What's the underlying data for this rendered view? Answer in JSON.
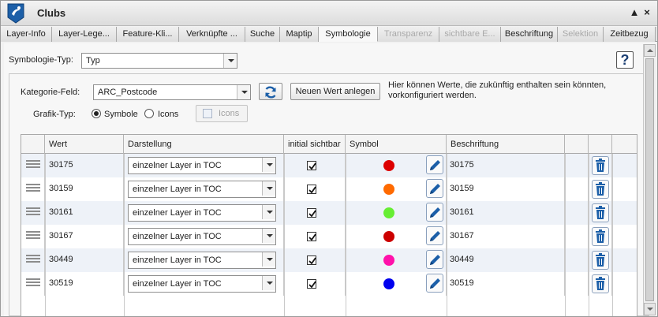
{
  "window": {
    "title": "Clubs",
    "collapse_glyph": "▲",
    "close_glyph": "×"
  },
  "tabs": [
    {
      "label": "Layer-Info",
      "state": "normal"
    },
    {
      "label": "Layer-Lege...",
      "state": "normal"
    },
    {
      "label": "Feature-Kli...",
      "state": "normal"
    },
    {
      "label": "Verknüpfte ...",
      "state": "normal"
    },
    {
      "label": "Suche",
      "state": "normal"
    },
    {
      "label": "Maptip",
      "state": "normal"
    },
    {
      "label": "Symbologie",
      "state": "active"
    },
    {
      "label": "Transparenz",
      "state": "disabled"
    },
    {
      "label": "sichtbare E...",
      "state": "disabled"
    },
    {
      "label": "Beschriftung",
      "state": "normal"
    },
    {
      "label": "Selektion",
      "state": "disabled"
    },
    {
      "label": "Zeitbezug",
      "state": "normal"
    }
  ],
  "symbology": {
    "type_label": "Symbologie-Typ:",
    "type_value": "Typ",
    "help_glyph": "?",
    "category_label": "Kategorie-Feld:",
    "category_value": "ARC_Postcode",
    "new_value_button": "Neuen Wert anlegen",
    "hint": "Hier können Werte, die zukünftig enthalten sein könnten, vorkonfiguriert werden.",
    "graphic_type_label": "Grafik-Typ:",
    "option_symbols": "Symbole",
    "option_icons": "Icons",
    "icons_button": "Icons",
    "selected_graphic_type": "Symbole"
  },
  "table": {
    "headers": {
      "wert": "Wert",
      "darstellung": "Darstellung",
      "initial_sichtbar": "initial sichtbar",
      "symbol": "Symbol",
      "beschriftung": "Beschriftung"
    },
    "rows": [
      {
        "wert": "30175",
        "darstellung": "einzelner Layer in TOC",
        "visible": true,
        "color": "#dd0000",
        "beschriftung": "30175"
      },
      {
        "wert": "30159",
        "darstellung": "einzelner Layer in TOC",
        "visible": true,
        "color": "#ff6a00",
        "beschriftung": "30159"
      },
      {
        "wert": "30161",
        "darstellung": "einzelner Layer in TOC",
        "visible": true,
        "color": "#66ee33",
        "beschriftung": "30161"
      },
      {
        "wert": "30167",
        "darstellung": "einzelner Layer in TOC",
        "visible": true,
        "color": "#cc0000",
        "beschriftung": "30167"
      },
      {
        "wert": "30449",
        "darstellung": "einzelner Layer in TOC",
        "visible": true,
        "color": "#ff11aa",
        "beschriftung": "30449"
      },
      {
        "wert": "30519",
        "darstellung": "einzelner Layer in TOC",
        "visible": true,
        "color": "#0000ee",
        "beschriftung": "30519"
      }
    ]
  },
  "colors": {
    "accent": "#1c5fa8",
    "row_alt": "#eef2f8"
  }
}
